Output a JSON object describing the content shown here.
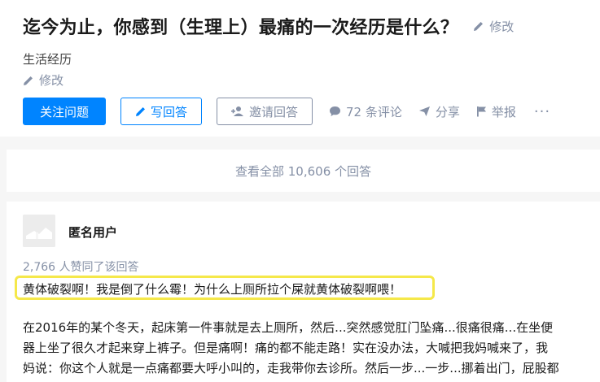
{
  "question": {
    "title": "迄今为止，你感到（生理上）最痛的一次经历是什么？",
    "edit_label": "修改",
    "topic": "生活经历",
    "topic_edit_label": "修改"
  },
  "actions": {
    "follow": "关注问题",
    "write_answer": "写回答",
    "invite": "邀请回答",
    "comments": "72 条评论",
    "share": "分享",
    "report": "举报",
    "more": "···"
  },
  "view_all": "查看全部 10,606 个回答",
  "answer": {
    "author": "匿名用户",
    "votes": "2,766 人赞同了该回答",
    "highlight": "黄体破裂啊！我是倒了什么霉！为什么上厕所拉个屎就黄体破裂啊喂！",
    "body_lines": [
      "在2016年的某个冬天，起床第一件事就是去上厕所，然后...突然感觉肛门坠痛...很痛很痛...在坐便",
      "器上坐了很久才起来穿上裤子。但是痛啊！痛的都不能走路！实在没办法，大喊把我妈喊来了，我",
      "妈说：你这个人就是一点痛都要大呼小叫的，走我带你去诊所。然后一步...一步...挪着出门，屁股都"
    ]
  },
  "colors": {
    "primary": "#0084ff",
    "muted": "#8590a6",
    "highlight_border": "#f5e84a",
    "page_bg": "#f6f6f6"
  }
}
